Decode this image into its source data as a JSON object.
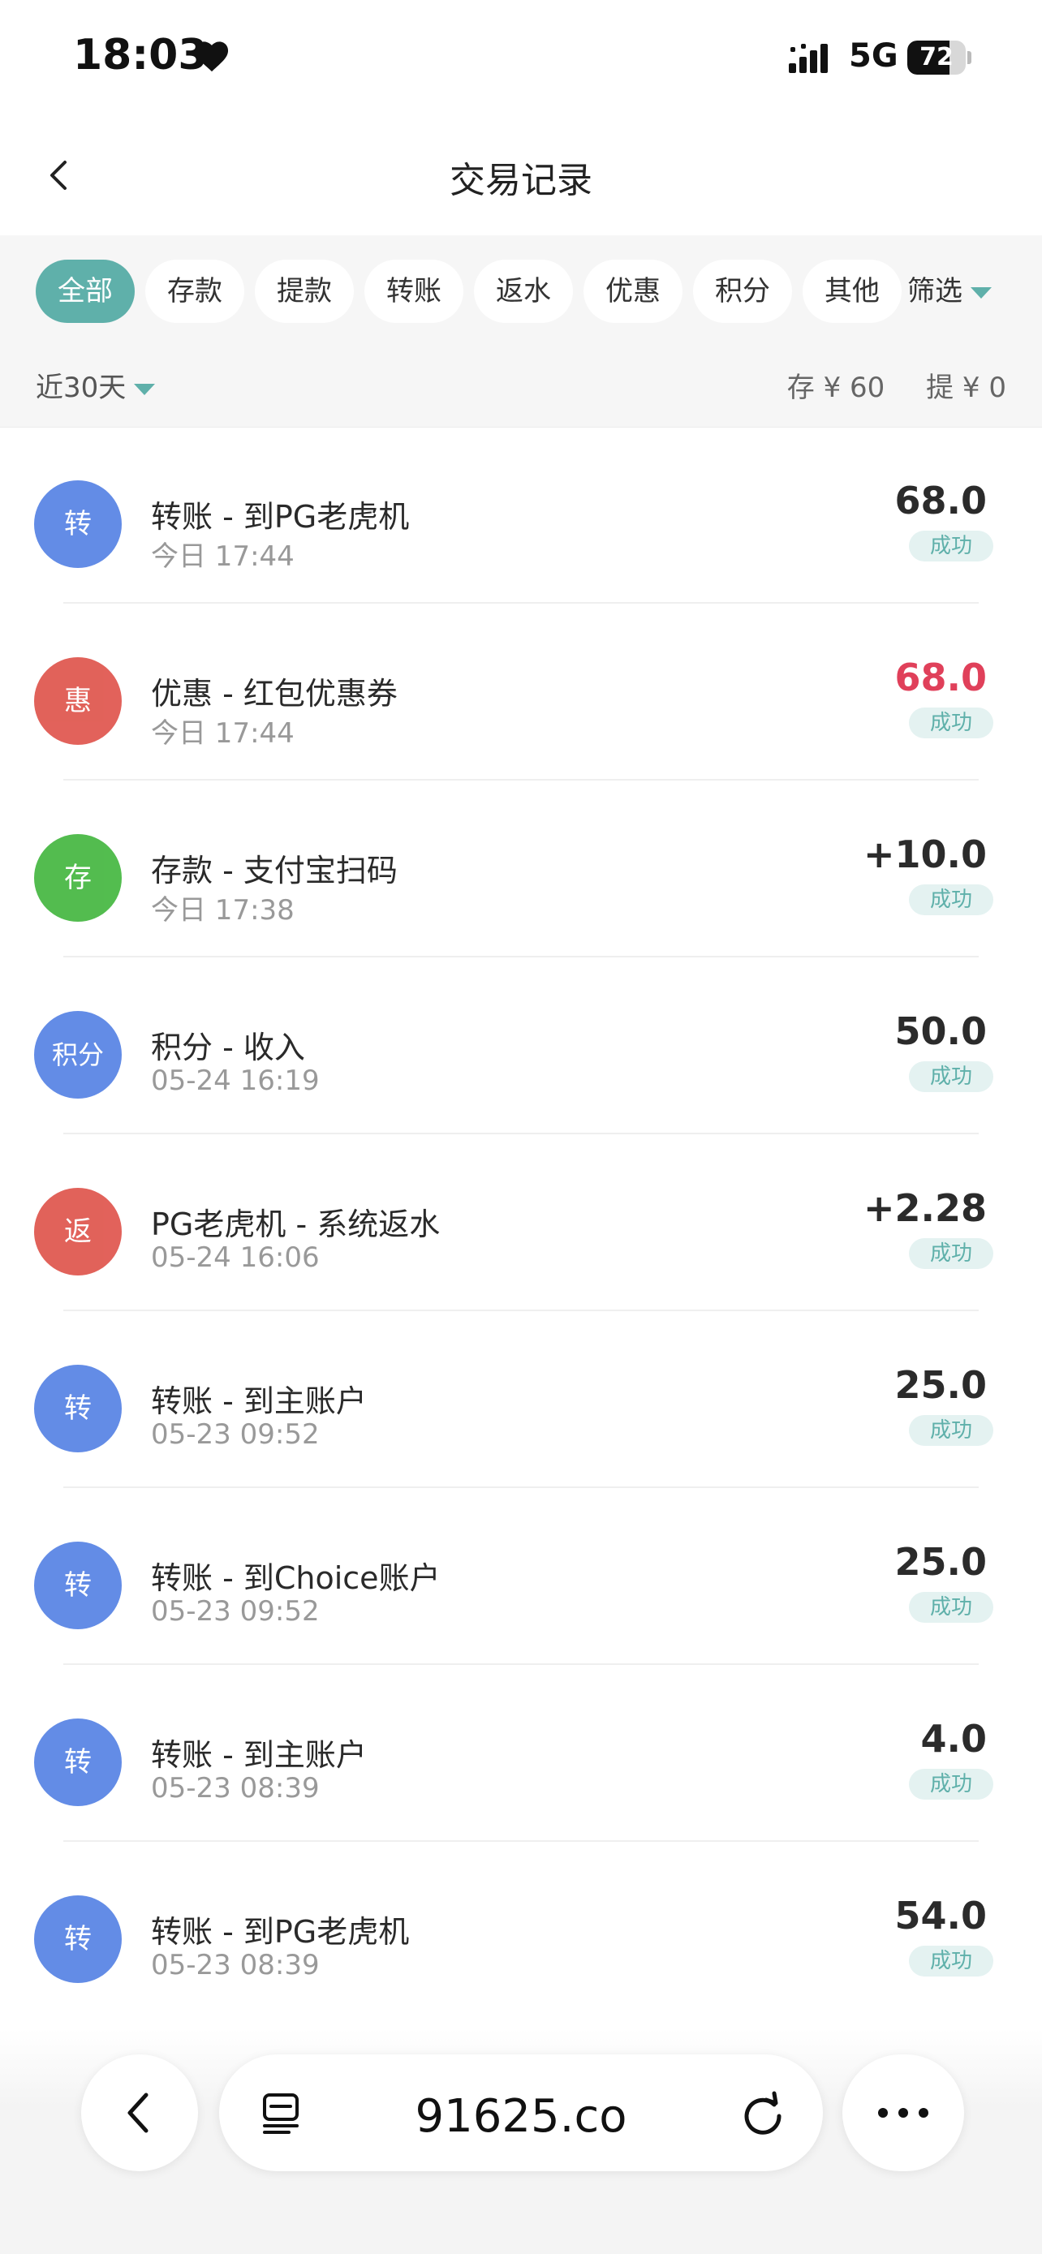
{
  "status_bar": {
    "time": "18:03",
    "network": "5G",
    "battery": "72",
    "battery_level": 0.72
  },
  "header": {
    "title": "交易记录"
  },
  "filters": {
    "tabs": [
      "全部",
      "存款",
      "提款",
      "转账",
      "返水",
      "优惠",
      "积分",
      "其他"
    ],
    "active_index": 0,
    "filter_label": "筛选",
    "range_label": "近30天",
    "deposit_summary": "存 ¥ 60",
    "withdraw_summary": "提 ¥ 0"
  },
  "transactions": [
    {
      "icon": "转",
      "color": "#5b86e5",
      "title": "转账 - 到PG老虎机",
      "time": "今日 17:44",
      "amount": "68.0",
      "status": "成功",
      "amount_color": "dark"
    },
    {
      "icon": "惠",
      "color": "#e05a52",
      "title": "优惠 - 红包优惠券",
      "time": "今日 17:44",
      "amount": "68.0",
      "status": "成功",
      "amount_color": "red"
    },
    {
      "icon": "存",
      "color": "#4ab946",
      "title": "存款 - 支付宝扫码",
      "time": "今日 17:38",
      "amount": "+10.0",
      "status": "成功",
      "amount_color": "dark"
    },
    {
      "icon": "积分",
      "color": "#5b86e5",
      "title": "积分 - 收入",
      "time": "05-24 16:19",
      "amount": "50.0",
      "status": "成功",
      "amount_color": "dark"
    },
    {
      "icon": "返",
      "color": "#e05a52",
      "title": "PG老虎机 - 系统返水",
      "time": "05-24 16:06",
      "amount": "+2.28",
      "status": "成功",
      "amount_color": "dark"
    },
    {
      "icon": "转",
      "color": "#5b86e5",
      "title": "转账 - 到主账户",
      "time": "05-23 09:52",
      "amount": "25.0",
      "status": "成功",
      "amount_color": "dark"
    },
    {
      "icon": "转",
      "color": "#5b86e5",
      "title": "转账 - 到Choice账户",
      "time": "05-23 09:52",
      "amount": "25.0",
      "status": "成功",
      "amount_color": "dark"
    },
    {
      "icon": "转",
      "color": "#5b86e5",
      "title": "转账 - 到主账户",
      "time": "05-23 08:39",
      "amount": "4.0",
      "status": "成功",
      "amount_color": "dark"
    },
    {
      "icon": "转",
      "color": "#5b86e5",
      "title": "转账 - 到PG老虎机",
      "time": "05-23 08:39",
      "amount": "54.0",
      "status": "成功",
      "amount_color": "dark"
    }
  ],
  "browser": {
    "url": "91625.co"
  }
}
